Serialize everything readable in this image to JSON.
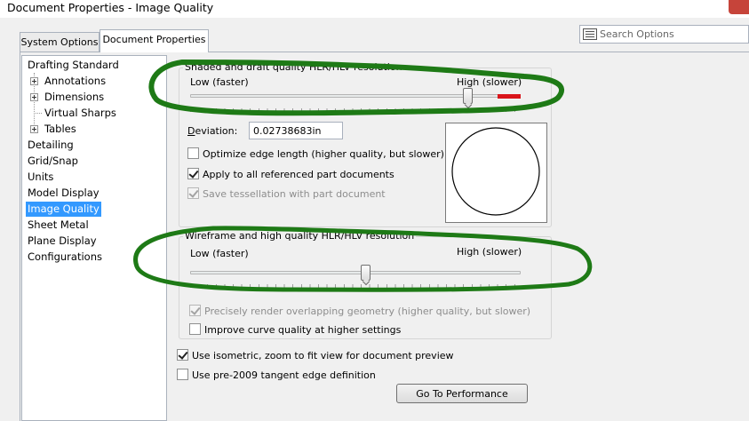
{
  "window": {
    "title": "Document Properties - Image Quality"
  },
  "tabs": [
    {
      "label": "System Options"
    },
    {
      "label": "Document Properties"
    }
  ],
  "search": {
    "placeholder": "Search Options"
  },
  "tree": {
    "items": [
      {
        "label": "Drafting Standard"
      },
      {
        "label": "Annotations"
      },
      {
        "label": "Dimensions"
      },
      {
        "label": "Virtual Sharps"
      },
      {
        "label": "Tables"
      },
      {
        "label": "Detailing"
      },
      {
        "label": "Grid/Snap"
      },
      {
        "label": "Units"
      },
      {
        "label": "Model Display"
      },
      {
        "label": "Image Quality"
      },
      {
        "label": "Sheet Metal"
      },
      {
        "label": "Plane Display"
      },
      {
        "label": "Configurations"
      }
    ],
    "selected": "Image Quality"
  },
  "shaded": {
    "title": "Shaded and draft quality HLR/HLV resolution",
    "low_label": "Low (faster)",
    "high_label": "High (slower)",
    "slider_level": 0.84,
    "deviation_label": "Deviation:",
    "deviation_value": "0.02738683in",
    "optimize_label": "Optimize edge length (higher quality, but slower)",
    "optimize_checked": false,
    "apply_label": "Apply to all referenced part documents",
    "apply_checked": true,
    "save_label": "Save tessellation with part document",
    "save_checked": true
  },
  "wireframe": {
    "title": "Wireframe and high quality HLR/HLV resolution",
    "low_label": "Low (faster)",
    "high_label": "High (slower)",
    "slider_level": 0.53,
    "precise_label": "Precisely render overlapping geometry (higher quality, but slower)",
    "precise_checked": true,
    "improve_label": "Improve curve quality at higher settings",
    "improve_checked": false
  },
  "options": {
    "isometric_label": "Use isometric, zoom to fit view for document preview",
    "isometric_checked": true,
    "pre2009_label": "Use pre-2009 tangent edge definition",
    "pre2009_checked": false
  },
  "performance_button": "Go To Performance",
  "colors": {
    "selection": "#3399ff",
    "annotation": "#1e7a16",
    "slider_red": "#d9141a"
  }
}
